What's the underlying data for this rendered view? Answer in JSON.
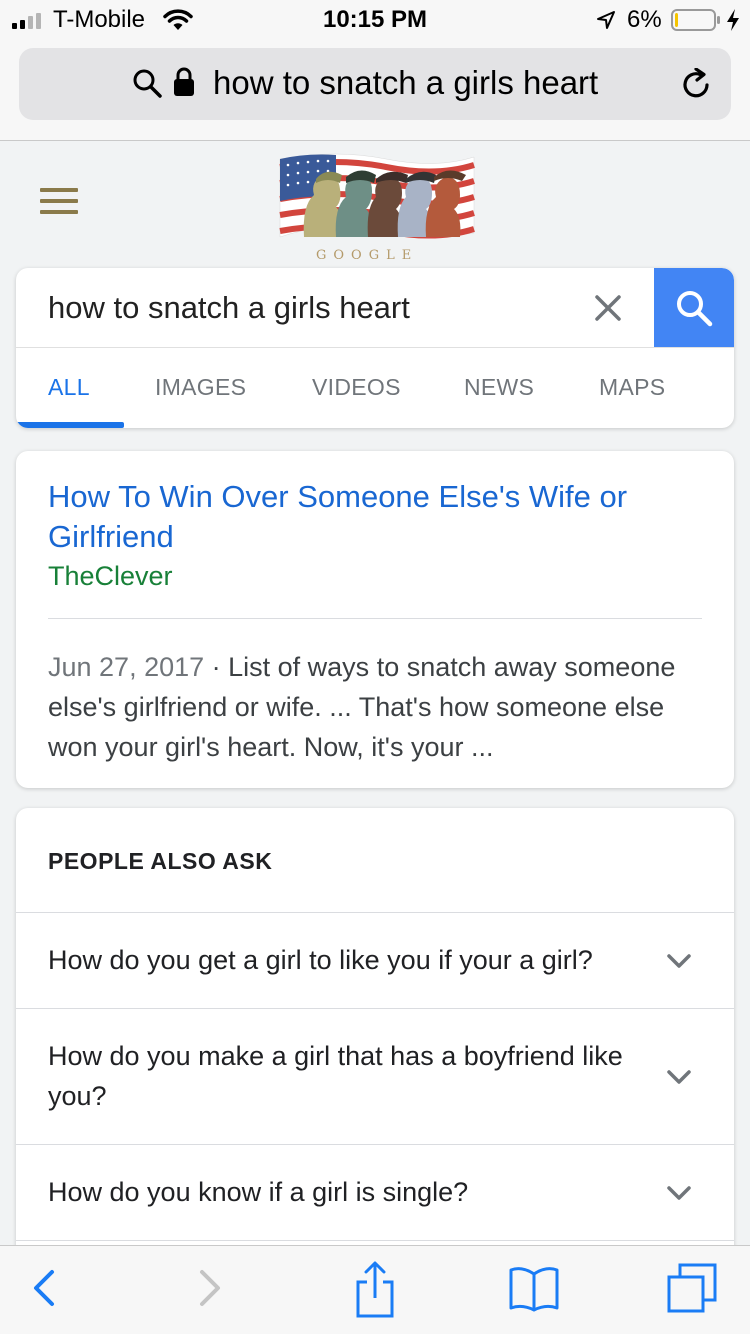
{
  "status_bar": {
    "carrier": "T-Mobile",
    "time": "10:15 PM",
    "battery_percent": "6%",
    "battery_level": 0.06,
    "battery_color": "#f5c400",
    "icons": [
      "signal-bars-icon",
      "wifi-icon",
      "location-arrow-icon",
      "battery-icon",
      "charging-bolt-icon"
    ]
  },
  "browser": {
    "url_text": "how to snatch a girls heart",
    "icons": [
      "search-icon",
      "lock-icon",
      "reload-icon"
    ]
  },
  "google": {
    "doodle_text": "GOOGLE",
    "search_query": "how to snatch a girls heart",
    "accent_color": "#4285f4",
    "tabs": [
      {
        "label": "ALL",
        "active": true
      },
      {
        "label": "IMAGES",
        "active": false
      },
      {
        "label": "VIDEOS",
        "active": false
      },
      {
        "label": "NEWS",
        "active": false
      },
      {
        "label": "MAPS",
        "active": false
      }
    ]
  },
  "result": {
    "title": "How To Win Over Someone Else's Wife or Girlfriend",
    "source": "TheClever",
    "date": "Jun 27, 2017",
    "snippet": " · List of ways to snatch away someone else's girlfriend or wife. ... That's how someone else won your girl's heart. Now, it's your ..."
  },
  "people_also_ask": {
    "heading": "PEOPLE ALSO ASK",
    "questions": [
      "How do you get a girl to like you if your a girl?",
      "How do you make a girl that has a boyfriend like you?",
      "How do you know if a girl is single?"
    ]
  },
  "toolbar": {
    "icons": [
      "back-icon",
      "forward-icon",
      "share-icon",
      "bookmarks-icon",
      "tabs-icon"
    ]
  }
}
